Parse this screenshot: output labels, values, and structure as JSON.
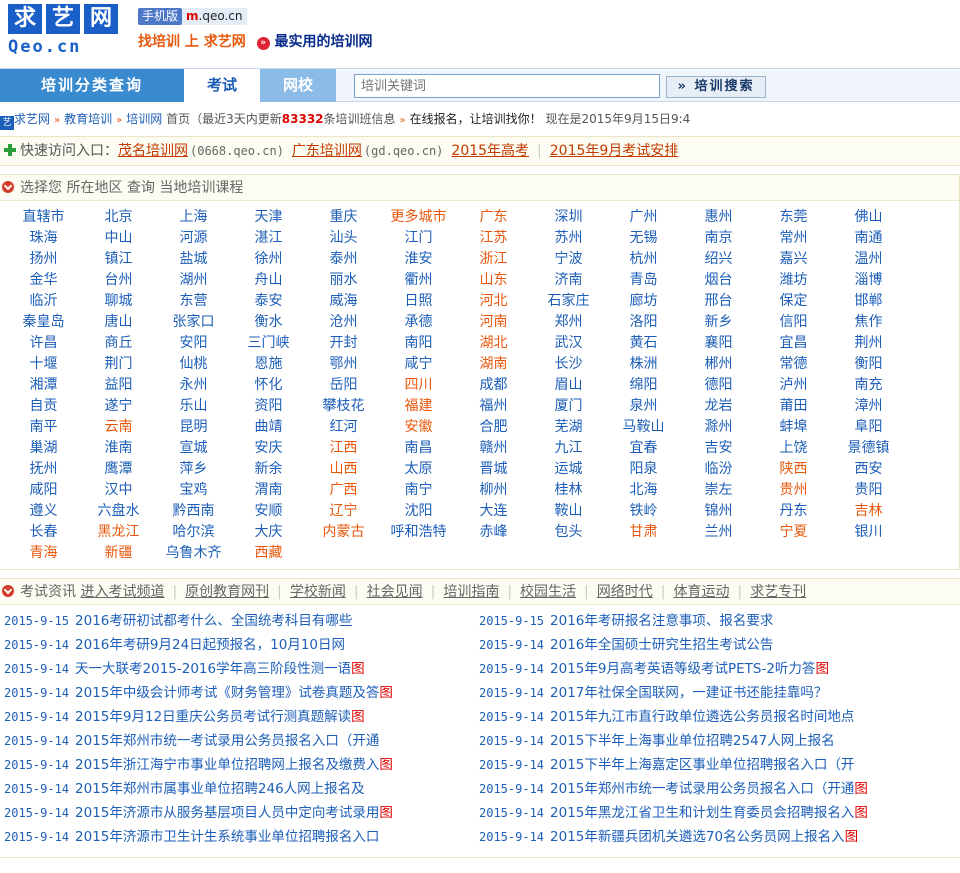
{
  "header": {
    "logo_cn": [
      "求",
      "艺",
      "网"
    ],
    "logo_en": "Qeo.cn",
    "mobile_tag": "手机版",
    "mobile_url_prefix": "m",
    "mobile_url_rest": ".qeo.cn",
    "slogan_left": "找培训 上 求艺网",
    "slogan_right": "最实用的培训网"
  },
  "nav": {
    "title": "培训分类查询",
    "tab_exam": "考试",
    "tab_school": "网校",
    "search_placeholder": "培训关键词",
    "search_button": "» 培训搜索"
  },
  "breadcrumb": {
    "icon_text": "艺",
    "home": "求艺网",
    "edu": "教育培训",
    "train": "培训网",
    "page": "首页",
    "update_prefix": "（最近3天内更新",
    "update_count": "83332",
    "update_suffix": "条培训班信息",
    "signup": "在线报名，让培训找你！",
    "now": "现在是2015年9月15日9:4"
  },
  "quick": {
    "label": "快速访问入口：",
    "link1": "茂名培训网",
    "dom1": "(0668.qeo.cn)",
    "link2": "广东培训网",
    "dom2": "(gd.qeo.cn)",
    "link3": "2015年高考",
    "link4": "2015年9月考试安排"
  },
  "cities": {
    "heading": "选择您 所在地区 查询 当地培训课程",
    "rows": [
      [
        [
          "直辖市",
          0
        ],
        [
          "北京",
          0
        ],
        [
          "上海",
          0
        ],
        [
          "天津",
          0
        ],
        [
          "重庆",
          0
        ],
        [
          "更多城市",
          1
        ],
        [
          "广东",
          1
        ],
        [
          "深圳",
          0
        ],
        [
          "广州",
          0
        ],
        [
          "惠州",
          0
        ],
        [
          "东莞",
          0
        ],
        [
          "佛山",
          0
        ]
      ],
      [
        [
          "珠海",
          0
        ],
        [
          "中山",
          0
        ],
        [
          "河源",
          0
        ],
        [
          "湛江",
          0
        ],
        [
          "汕头",
          0
        ],
        [
          "江门",
          0
        ],
        [
          "江苏",
          1
        ],
        [
          "苏州",
          0
        ],
        [
          "无锡",
          0
        ],
        [
          "南京",
          0
        ],
        [
          "常州",
          0
        ],
        [
          "南通",
          0
        ]
      ],
      [
        [
          "扬州",
          0
        ],
        [
          "镇江",
          0
        ],
        [
          "盐城",
          0
        ],
        [
          "徐州",
          0
        ],
        [
          "泰州",
          0
        ],
        [
          "淮安",
          0
        ],
        [
          "浙江",
          1
        ],
        [
          "宁波",
          0
        ],
        [
          "杭州",
          0
        ],
        [
          "绍兴",
          0
        ],
        [
          "嘉兴",
          0
        ],
        [
          "温州",
          0
        ]
      ],
      [
        [
          "金华",
          0
        ],
        [
          "台州",
          0
        ],
        [
          "湖州",
          0
        ],
        [
          "舟山",
          0
        ],
        [
          "丽水",
          0
        ],
        [
          "衢州",
          0
        ],
        [
          "山东",
          1
        ],
        [
          "济南",
          0
        ],
        [
          "青岛",
          0
        ],
        [
          "烟台",
          0
        ],
        [
          "潍坊",
          0
        ],
        [
          "淄博",
          0
        ]
      ],
      [
        [
          "临沂",
          0
        ],
        [
          "聊城",
          0
        ],
        [
          "东营",
          0
        ],
        [
          "泰安",
          0
        ],
        [
          "威海",
          0
        ],
        [
          "日照",
          0
        ],
        [
          "河北",
          1
        ],
        [
          "石家庄",
          0
        ],
        [
          "廊坊",
          0
        ],
        [
          "邢台",
          0
        ],
        [
          "保定",
          0
        ],
        [
          "邯郸",
          0
        ]
      ],
      [
        [
          "秦皇岛",
          0
        ],
        [
          "唐山",
          0
        ],
        [
          "张家口",
          0
        ],
        [
          "衡水",
          0
        ],
        [
          "沧州",
          0
        ],
        [
          "承德",
          0
        ],
        [
          "河南",
          1
        ],
        [
          "郑州",
          0
        ],
        [
          "洛阳",
          0
        ],
        [
          "新乡",
          0
        ],
        [
          "信阳",
          0
        ],
        [
          "焦作",
          0
        ]
      ],
      [
        [
          "许昌",
          0
        ],
        [
          "商丘",
          0
        ],
        [
          "安阳",
          0
        ],
        [
          "三门峡",
          0
        ],
        [
          "开封",
          0
        ],
        [
          "南阳",
          0
        ],
        [
          "湖北",
          1
        ],
        [
          "武汉",
          0
        ],
        [
          "黄石",
          0
        ],
        [
          "襄阳",
          0
        ],
        [
          "宜昌",
          0
        ],
        [
          "荆州",
          0
        ]
      ],
      [
        [
          "十堰",
          0
        ],
        [
          "荆门",
          0
        ],
        [
          "仙桃",
          0
        ],
        [
          "恩施",
          0
        ],
        [
          "鄂州",
          0
        ],
        [
          "咸宁",
          0
        ],
        [
          "湖南",
          1
        ],
        [
          "长沙",
          0
        ],
        [
          "株洲",
          0
        ],
        [
          "郴州",
          0
        ],
        [
          "常德",
          0
        ],
        [
          "衡阳",
          0
        ]
      ],
      [
        [
          "湘潭",
          0
        ],
        [
          "益阳",
          0
        ],
        [
          "永州",
          0
        ],
        [
          "怀化",
          0
        ],
        [
          "岳阳",
          0
        ],
        [
          "四川",
          1
        ],
        [
          "成都",
          0
        ],
        [
          "眉山",
          0
        ],
        [
          "绵阳",
          0
        ],
        [
          "德阳",
          0
        ],
        [
          "泸州",
          0
        ],
        [
          "南充",
          0
        ]
      ],
      [
        [
          "自贡",
          0
        ],
        [
          "遂宁",
          0
        ],
        [
          "乐山",
          0
        ],
        [
          "资阳",
          0
        ],
        [
          "攀枝花",
          0
        ],
        [
          "福建",
          1
        ],
        [
          "福州",
          0
        ],
        [
          "厦门",
          0
        ],
        [
          "泉州",
          0
        ],
        [
          "龙岩",
          0
        ],
        [
          "莆田",
          0
        ],
        [
          "漳州",
          0
        ]
      ],
      [
        [
          "南平",
          0
        ],
        [
          "云南",
          1
        ],
        [
          "昆明",
          0
        ],
        [
          "曲靖",
          0
        ],
        [
          "红河",
          0
        ],
        [
          "安徽",
          1
        ],
        [
          "合肥",
          0
        ],
        [
          "芜湖",
          0
        ],
        [
          "马鞍山",
          0
        ],
        [
          "滁州",
          0
        ],
        [
          "蚌埠",
          0
        ],
        [
          "阜阳",
          0
        ]
      ],
      [
        [
          "巢湖",
          0
        ],
        [
          "淮南",
          0
        ],
        [
          "宣城",
          0
        ],
        [
          "安庆",
          0
        ],
        [
          "江西",
          1
        ],
        [
          "南昌",
          0
        ],
        [
          "赣州",
          0
        ],
        [
          "九江",
          0
        ],
        [
          "宜春",
          0
        ],
        [
          "吉安",
          0
        ],
        [
          "上饶",
          0
        ],
        [
          "景德镇",
          0
        ]
      ],
      [
        [
          "抚州",
          0
        ],
        [
          "鹰潭",
          0
        ],
        [
          "萍乡",
          0
        ],
        [
          "新余",
          0
        ],
        [
          "山西",
          1
        ],
        [
          "太原",
          0
        ],
        [
          "晋城",
          0
        ],
        [
          "运城",
          0
        ],
        [
          "阳泉",
          0
        ],
        [
          "临汾",
          0
        ],
        [
          "陕西",
          1
        ],
        [
          "西安",
          0
        ]
      ],
      [
        [
          "咸阳",
          0
        ],
        [
          "汉中",
          0
        ],
        [
          "宝鸡",
          0
        ],
        [
          "渭南",
          0
        ],
        [
          "广西",
          1
        ],
        [
          "南宁",
          0
        ],
        [
          "柳州",
          0
        ],
        [
          "桂林",
          0
        ],
        [
          "北海",
          0
        ],
        [
          "崇左",
          0
        ],
        [
          "贵州",
          1
        ],
        [
          "贵阳",
          0
        ]
      ],
      [
        [
          "遵义",
          0
        ],
        [
          "六盘水",
          0
        ],
        [
          "黔西南",
          0
        ],
        [
          "安顺",
          0
        ],
        [
          "辽宁",
          1
        ],
        [
          "沈阳",
          0
        ],
        [
          "大连",
          0
        ],
        [
          "鞍山",
          0
        ],
        [
          "铁岭",
          0
        ],
        [
          "锦州",
          0
        ],
        [
          "丹东",
          0
        ],
        [
          "吉林",
          1
        ]
      ],
      [
        [
          "长春",
          0
        ],
        [
          "黑龙江",
          1
        ],
        [
          "哈尔滨",
          0
        ],
        [
          "大庆",
          0
        ],
        [
          "内蒙古",
          1
        ],
        [
          "呼和浩特",
          0
        ],
        [
          "赤峰",
          0
        ],
        [
          "包头",
          0
        ],
        [
          "甘肃",
          1
        ],
        [
          "兰州",
          0
        ],
        [
          "宁夏",
          1
        ],
        [
          "银川",
          0
        ]
      ],
      [
        [
          "青海",
          1
        ],
        [
          "新疆",
          1
        ],
        [
          "乌鲁木齐",
          0
        ],
        [
          "西藏",
          1
        ]
      ]
    ]
  },
  "news": {
    "heading": "考试资讯",
    "tabs": [
      "进入考试频道",
      "原创教育网刊",
      "学校新闻",
      "社会见闻",
      "培训指南",
      "校园生活",
      "网络时代",
      "体育运动",
      "求艺专刊"
    ],
    "pic_marker": "图",
    "left": [
      {
        "date": "2015-9-15",
        "title": "2016考研初试都考什么、全国统考科目有哪些",
        "pic": false
      },
      {
        "date": "2015-9-14",
        "title": "2016年考研9月24日起预报名，10月10日网",
        "pic": false
      },
      {
        "date": "2015-9-14",
        "title": "天一大联考2015-2016学年高三阶段性测一语",
        "pic": true
      },
      {
        "date": "2015-9-14",
        "title": "2015年中级会计师考试《财务管理》试卷真题及答",
        "pic": true
      },
      {
        "date": "2015-9-14",
        "title": "2015年9月12日重庆公务员考试行测真题解读",
        "pic": true
      },
      {
        "date": "2015-9-14",
        "title": "2015年郑州市统一考试录用公务员报名入口（开通",
        "pic": false
      },
      {
        "date": "2015-9-14",
        "title": "2015年浙江海宁市事业单位招聘网上报名及缴费入",
        "pic": true
      },
      {
        "date": "2015-9-14",
        "title": "2015年郑州市属事业单位招聘246人网上报名及",
        "pic": false
      },
      {
        "date": "2015-9-14",
        "title": "2015年济源市从服务基层项目人员中定向考试录用",
        "pic": true
      },
      {
        "date": "2015-9-14",
        "title": "2015年济源市卫生计生系统事业单位招聘报名入口",
        "pic": false
      }
    ],
    "right": [
      {
        "date": "2015-9-15",
        "title": "2016年考研报名注意事项、报名要求",
        "pic": false
      },
      {
        "date": "2015-9-14",
        "title": "2016年全国硕士研究生招生考试公告",
        "pic": false
      },
      {
        "date": "2015-9-14",
        "title": "2015年9月高考英语等级考试PETS-2听力答",
        "pic": true
      },
      {
        "date": "2015-9-14",
        "title": "2017年社保全国联网，一建证书还能挂靠吗？",
        "pic": false
      },
      {
        "date": "2015-9-14",
        "title": "2015年九江市直行政单位遴选公务员报名时间地点",
        "pic": false
      },
      {
        "date": "2015-9-14",
        "title": "2015下半年上海事业单位招聘2547人网上报名",
        "pic": false
      },
      {
        "date": "2015-9-14",
        "title": "2015下半年上海嘉定区事业单位招聘报名入口（开",
        "pic": false
      },
      {
        "date": "2015-9-14",
        "title": "2015年郑州市统一考试录用公务员报名入口（开通",
        "pic": true
      },
      {
        "date": "2015-9-14",
        "title": "2015年黑龙江省卫生和计划生育委员会招聘报名入",
        "pic": true
      },
      {
        "date": "2015-9-14",
        "title": "2015年新疆兵团机关遴选70名公务员网上报名入",
        "pic": true
      }
    ]
  }
}
